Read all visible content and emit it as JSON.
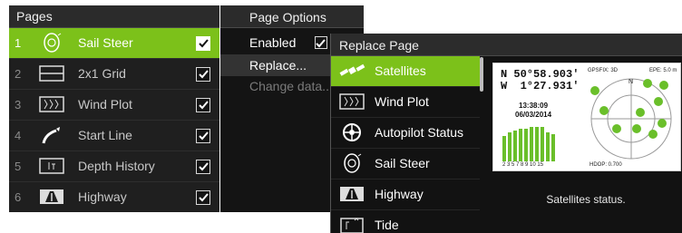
{
  "pages_panel": {
    "title": "Pages",
    "items": [
      {
        "num": "1",
        "label": "Sail Steer",
        "icon": "sail-steer-icon",
        "checked": true,
        "selected": true
      },
      {
        "num": "2",
        "label": "2x1 Grid",
        "icon": "grid-icon",
        "checked": true,
        "selected": false
      },
      {
        "num": "3",
        "label": "Wind Plot",
        "icon": "wind-plot-icon",
        "checked": true,
        "selected": false
      },
      {
        "num": "4",
        "label": "Start Line",
        "icon": "start-line-icon",
        "checked": true,
        "selected": false
      },
      {
        "num": "5",
        "label": "Depth History",
        "icon": "depth-history-icon",
        "checked": true,
        "selected": false
      },
      {
        "num": "6",
        "label": "Highway",
        "icon": "highway-icon",
        "checked": true,
        "selected": false
      }
    ]
  },
  "options_panel": {
    "title": "Page Options",
    "enabled": "Enabled",
    "replace": "Replace...",
    "change_data": "Change data..."
  },
  "replace_panel": {
    "title": "Replace Page",
    "items": [
      {
        "label": "Satellites",
        "icon": "satellite-icon",
        "selected": true
      },
      {
        "label": "Wind Plot",
        "icon": "wind-plot-icon",
        "selected": false
      },
      {
        "label": "Autopilot Status",
        "icon": "autopilot-icon",
        "selected": false
      },
      {
        "label": "Sail Steer",
        "icon": "sail-steer-icon",
        "selected": false
      },
      {
        "label": "Highway",
        "icon": "highway-icon",
        "selected": false
      },
      {
        "label": "Tide",
        "icon": "tide-icon",
        "selected": false
      }
    ],
    "preview": {
      "lat": "N 50°58.903'",
      "lon": "W  1°27.931'",
      "time": "13:38:09",
      "date": "06/03/2014",
      "gpsfix": "GPSFIX: 3D",
      "epe": "EPE: 5.0 m",
      "hdop": "HDOP: 0.700",
      "north": "N",
      "axis_labels": "2 3 5 7 8 9 10 15",
      "satellites": [
        "2",
        "5",
        "7",
        "8",
        "9",
        "10",
        "15",
        "13",
        "17",
        "21"
      ]
    },
    "status": "Satellites status."
  },
  "colors": {
    "accent": "#7cc11a",
    "panel": "#1f1f1f"
  }
}
